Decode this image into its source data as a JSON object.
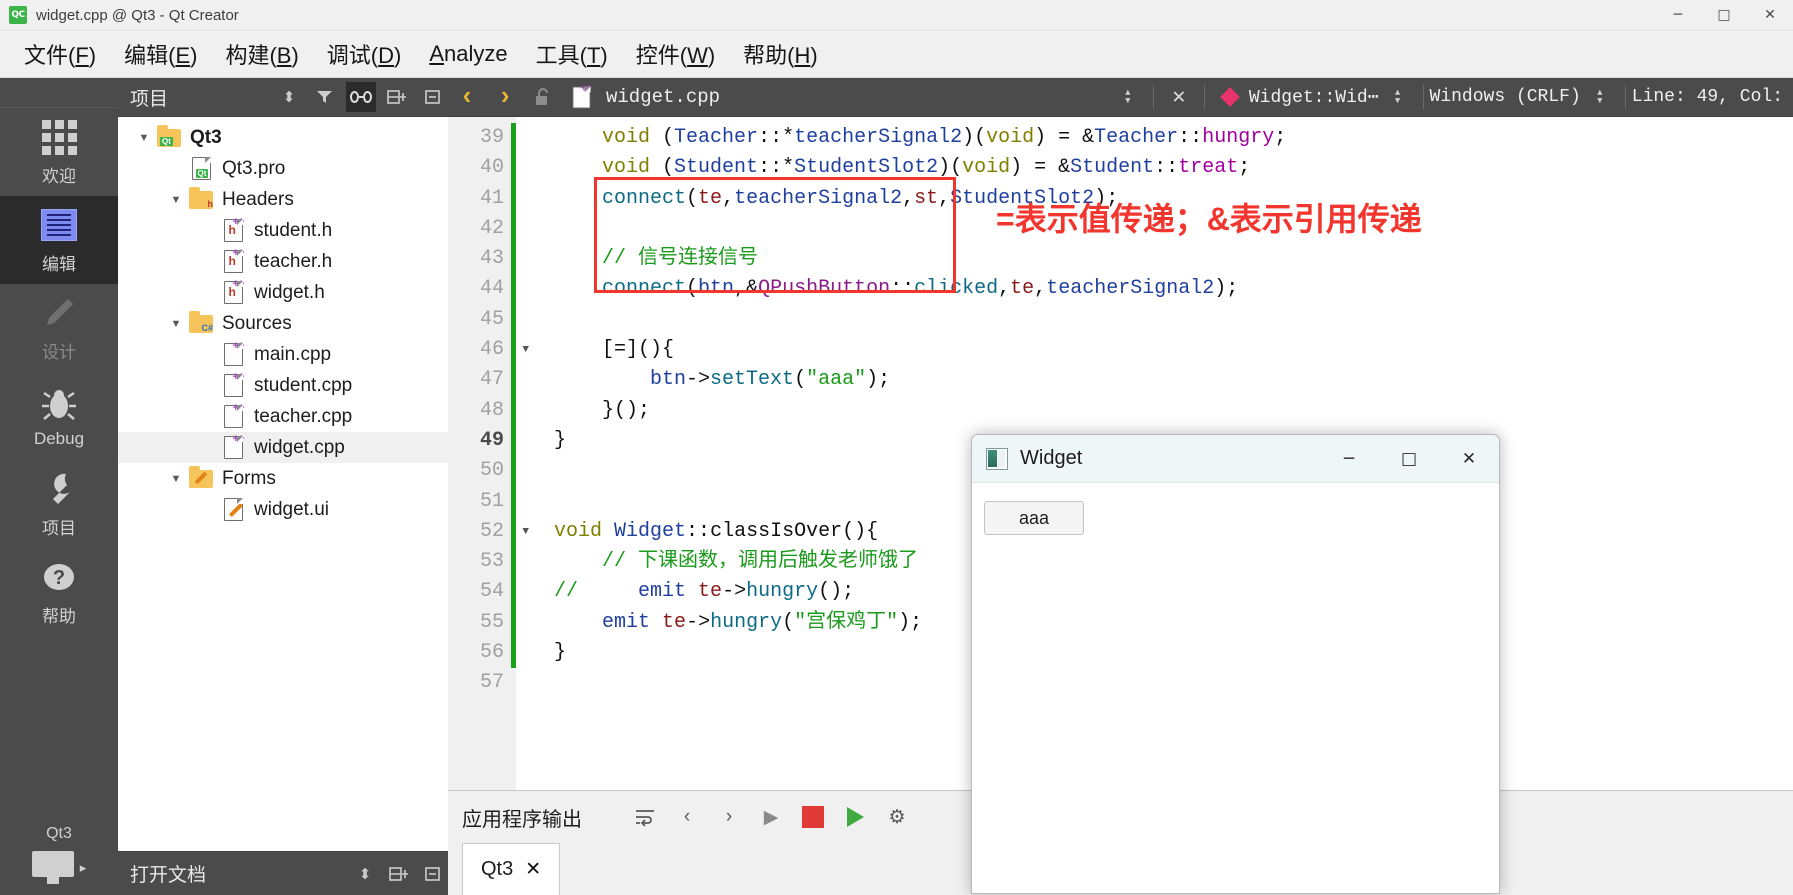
{
  "window": {
    "title": "widget.cpp @ Qt3 - Qt Creator",
    "app_badge": "QC",
    "minimize": "─",
    "maximize": "□",
    "close": "✕"
  },
  "menubar": [
    {
      "label": "文件(F)",
      "mnemonic": "F"
    },
    {
      "label": "编辑(E)",
      "mnemonic": "E"
    },
    {
      "label": "构建(B)",
      "mnemonic": "B"
    },
    {
      "label": "调试(D)",
      "mnemonic": "D"
    },
    {
      "label": "Analyze",
      "mnemonic": "A"
    },
    {
      "label": "工具(T)",
      "mnemonic": "T"
    },
    {
      "label": "控件(W)",
      "mnemonic": "W"
    },
    {
      "label": "帮助(H)",
      "mnemonic": "H"
    }
  ],
  "modebar": {
    "items": [
      {
        "label": "欢迎",
        "icon": "grid-icon",
        "state": "normal"
      },
      {
        "label": "编辑",
        "icon": "edit-lines-icon",
        "state": "active"
      },
      {
        "label": "设计",
        "icon": "pencil-icon",
        "state": "disabled"
      },
      {
        "label": "Debug",
        "icon": "bug-icon",
        "state": "normal"
      },
      {
        "label": "项目",
        "icon": "wrench-icon",
        "state": "normal"
      },
      {
        "label": "帮助",
        "icon": "question-circle-icon",
        "state": "normal"
      }
    ],
    "project_name": "Qt3",
    "target_arrow": "▸"
  },
  "project_panel": {
    "title": "项目",
    "toolbar": {
      "sync_spin": "⬍",
      "filter_icon": "filter-icon",
      "link_icon": "link-icon",
      "split_icon": "split-icon",
      "collapse_icon": "collapse-icon"
    },
    "tree": [
      {
        "label": "Qt3",
        "indent": 0,
        "icon": "qt-folder-icon",
        "arrow": "▼",
        "bold": true,
        "selected": false
      },
      {
        "label": "Qt3.pro",
        "indent": 1,
        "icon": "qt-pro-file-icon",
        "arrow": "",
        "bold": false,
        "selected": false
      },
      {
        "label": "Headers",
        "indent": 1,
        "icon": "headers-folder-icon",
        "arrow": "▼",
        "bold": false,
        "selected": false
      },
      {
        "label": "student.h",
        "indent": 2,
        "icon": "h-file-icon",
        "arrow": "",
        "bold": false,
        "selected": false
      },
      {
        "label": "teacher.h",
        "indent": 2,
        "icon": "h-file-icon",
        "arrow": "",
        "bold": false,
        "selected": false
      },
      {
        "label": "widget.h",
        "indent": 2,
        "icon": "h-file-icon",
        "arrow": "",
        "bold": false,
        "selected": false
      },
      {
        "label": "Sources",
        "indent": 1,
        "icon": "sources-folder-icon",
        "arrow": "▼",
        "bold": false,
        "selected": false
      },
      {
        "label": "main.cpp",
        "indent": 2,
        "icon": "cpp-file-icon",
        "arrow": "",
        "bold": false,
        "selected": false
      },
      {
        "label": "student.cpp",
        "indent": 2,
        "icon": "cpp-file-icon",
        "arrow": "",
        "bold": false,
        "selected": false
      },
      {
        "label": "teacher.cpp",
        "indent": 2,
        "icon": "cpp-file-icon",
        "arrow": "",
        "bold": false,
        "selected": false
      },
      {
        "label": "widget.cpp",
        "indent": 2,
        "icon": "cpp-file-icon",
        "arrow": "",
        "bold": false,
        "selected": true
      },
      {
        "label": "Forms",
        "indent": 1,
        "icon": "forms-folder-icon",
        "arrow": "▼",
        "bold": false,
        "selected": false
      },
      {
        "label": "widget.ui",
        "indent": 2,
        "icon": "ui-file-icon",
        "arrow": "",
        "bold": false,
        "selected": false
      }
    ],
    "footer_title": "打开文档"
  },
  "editor": {
    "toolbar": {
      "back_arrow": "‹",
      "forward_arrow": "›",
      "lock_icon": "unlocked-icon",
      "file_icon": "cpp-file-icon",
      "file_name": "widget.cpp",
      "file_spin": "⬍",
      "close_icon": "✕",
      "symbol_marker": "diamond-icon",
      "symbol_name": "Widget::Wid⋯",
      "symbol_spin": "⬍",
      "line_ending": "Windows (CRLF)",
      "line_ending_spin": "⬍",
      "cursor_position": "Line: 49, Col:"
    },
    "first_line_number": 39,
    "current_line": 49,
    "lines": [
      {
        "n": 39,
        "fold": false,
        "tokens": [
          {
            "t": "    ",
            "c": "k-op"
          },
          {
            "t": "void",
            "c": "k-type"
          },
          {
            "t": " (",
            "c": "k-op"
          },
          {
            "t": "Teacher",
            "c": "k-cls"
          },
          {
            "t": "::*",
            "c": "k-op"
          },
          {
            "t": "teacherSignal2",
            "c": "k-var"
          },
          {
            "t": ")(",
            "c": "k-op"
          },
          {
            "t": "void",
            "c": "k-type"
          },
          {
            "t": ") = &",
            "c": "k-op"
          },
          {
            "t": "Teacher",
            "c": "k-cls"
          },
          {
            "t": "::",
            "c": "k-op"
          },
          {
            "t": "hungry",
            "c": "k-pnk"
          },
          {
            "t": ";",
            "c": "k-op"
          }
        ]
      },
      {
        "n": 40,
        "fold": false,
        "tokens": [
          {
            "t": "    ",
            "c": "k-op"
          },
          {
            "t": "void",
            "c": "k-type"
          },
          {
            "t": " (",
            "c": "k-op"
          },
          {
            "t": "Student",
            "c": "k-cls"
          },
          {
            "t": "::*",
            "c": "k-op"
          },
          {
            "t": "StudentSlot2",
            "c": "k-var"
          },
          {
            "t": ")(",
            "c": "k-op"
          },
          {
            "t": "void",
            "c": "k-type"
          },
          {
            "t": ") = &",
            "c": "k-op"
          },
          {
            "t": "Student",
            "c": "k-cls"
          },
          {
            "t": "::",
            "c": "k-op"
          },
          {
            "t": "treat",
            "c": "k-pnk"
          },
          {
            "t": ";",
            "c": "k-op"
          }
        ]
      },
      {
        "n": 41,
        "fold": false,
        "tokens": [
          {
            "t": "    ",
            "c": "k-op"
          },
          {
            "t": "connect",
            "c": "k-fn"
          },
          {
            "t": "(",
            "c": "k-op"
          },
          {
            "t": "te",
            "c": "k-mem"
          },
          {
            "t": ",",
            "c": "k-op"
          },
          {
            "t": "teacherSignal2",
            "c": "k-var"
          },
          {
            "t": ",",
            "c": "k-op"
          },
          {
            "t": "st",
            "c": "k-mem"
          },
          {
            "t": ",",
            "c": "k-op"
          },
          {
            "t": "StudentSlot2",
            "c": "k-var"
          },
          {
            "t": ");",
            "c": "k-op"
          }
        ]
      },
      {
        "n": 42,
        "fold": false,
        "tokens": []
      },
      {
        "n": 43,
        "fold": false,
        "tokens": [
          {
            "t": "    ",
            "c": "k-op"
          },
          {
            "t": "// 信号连接信号",
            "c": "k-cmt"
          }
        ]
      },
      {
        "n": 44,
        "fold": false,
        "tokens": [
          {
            "t": "    ",
            "c": "k-op"
          },
          {
            "t": "connect",
            "c": "k-fn"
          },
          {
            "t": "(",
            "c": "k-op"
          },
          {
            "t": "btn",
            "c": "k-var"
          },
          {
            "t": ",&",
            "c": "k-op"
          },
          {
            "t": "QPushButton",
            "c": "k-mac"
          },
          {
            "t": "::",
            "c": "k-op"
          },
          {
            "t": "clicked",
            "c": "k-fn"
          },
          {
            "t": ",",
            "c": "k-op"
          },
          {
            "t": "te",
            "c": "k-mem"
          },
          {
            "t": ",",
            "c": "k-op"
          },
          {
            "t": "teacherSignal2",
            "c": "k-var"
          },
          {
            "t": ");",
            "c": "k-op"
          }
        ]
      },
      {
        "n": 45,
        "fold": false,
        "tokens": []
      },
      {
        "n": 46,
        "fold": true,
        "tokens": [
          {
            "t": "    [=](){",
            "c": "k-op"
          }
        ]
      },
      {
        "n": 47,
        "fold": false,
        "tokens": [
          {
            "t": "        ",
            "c": "k-op"
          },
          {
            "t": "btn",
            "c": "k-var"
          },
          {
            "t": "->",
            "c": "k-op"
          },
          {
            "t": "setText",
            "c": "k-fn"
          },
          {
            "t": "(",
            "c": "k-op"
          },
          {
            "t": "\"aaa\"",
            "c": "k-str"
          },
          {
            "t": ");",
            "c": "k-op"
          }
        ]
      },
      {
        "n": 48,
        "fold": false,
        "tokens": [
          {
            "t": "    }();",
            "c": "k-op"
          }
        ]
      },
      {
        "n": 49,
        "fold": false,
        "tokens": [
          {
            "t": "}",
            "c": "k-op"
          }
        ]
      },
      {
        "n": 50,
        "fold": false,
        "tokens": []
      },
      {
        "n": 51,
        "fold": false,
        "tokens": []
      },
      {
        "n": 52,
        "fold": true,
        "tokens": [
          {
            "t": "void",
            "c": "k-type"
          },
          {
            "t": " ",
            "c": "k-op"
          },
          {
            "t": "Widget",
            "c": "k-cls"
          },
          {
            "t": "::",
            "c": "k-op"
          },
          {
            "t": "classIsOver",
            "c": "k-op"
          },
          {
            "t": "(){",
            "c": "k-op"
          }
        ]
      },
      {
        "n": 53,
        "fold": false,
        "tokens": [
          {
            "t": "    ",
            "c": "k-op"
          },
          {
            "t": "// 下课函数，调用后触发老师饿了",
            "c": "k-cmt"
          }
        ]
      },
      {
        "n": 54,
        "fold": false,
        "tokens": [
          {
            "t": "//   ",
            "c": "k-cmt"
          },
          {
            "t": "  emit",
            "c": "k-var"
          },
          {
            "t": " ",
            "c": "k-op"
          },
          {
            "t": "te",
            "c": "k-mem"
          },
          {
            "t": "->",
            "c": "k-op"
          },
          {
            "t": "hungry",
            "c": "k-fn"
          },
          {
            "t": "();",
            "c": "k-op"
          }
        ]
      },
      {
        "n": 55,
        "fold": false,
        "tokens": [
          {
            "t": "    ",
            "c": "k-op"
          },
          {
            "t": "emit",
            "c": "k-var"
          },
          {
            "t": " ",
            "c": "k-op"
          },
          {
            "t": "te",
            "c": "k-mem"
          },
          {
            "t": "->",
            "c": "k-op"
          },
          {
            "t": "hungry",
            "c": "k-fn"
          },
          {
            "t": "(",
            "c": "k-op"
          },
          {
            "t": "\"宫保鸡丁\"",
            "c": "k-str"
          },
          {
            "t": ");",
            "c": "k-op"
          }
        ]
      },
      {
        "n": 56,
        "fold": false,
        "tokens": [
          {
            "t": "}",
            "c": "k-op"
          }
        ]
      },
      {
        "n": 57,
        "fold": false,
        "tokens": []
      }
    ],
    "annotation": "=表示值传递；&表示引用传递",
    "annotation_color": "#f2352d"
  },
  "output_pane": {
    "title": "应用程序输出",
    "buttons": [
      {
        "icon": "wrap-lines-icon",
        "label": "⤓"
      },
      {
        "icon": "prev-icon",
        "label": "‹"
      },
      {
        "icon": "next-icon",
        "label": "›"
      },
      {
        "icon": "run-icon",
        "label": "▶"
      },
      {
        "icon": "stop-icon",
        "label": "■"
      },
      {
        "icon": "run-green-icon",
        "label": "▶"
      },
      {
        "icon": "gear-icon",
        "label": "⚙"
      }
    ],
    "stop_color": "#e03b36",
    "run_color": "#3faa3f",
    "tabs": [
      {
        "label": "Qt3",
        "close": "✕",
        "active": true
      }
    ]
  },
  "dialog": {
    "title": "Widget",
    "icon": "widget-app-icon",
    "minimize": "─",
    "maximize": "□",
    "close": "✕",
    "button_label": "aaa"
  }
}
